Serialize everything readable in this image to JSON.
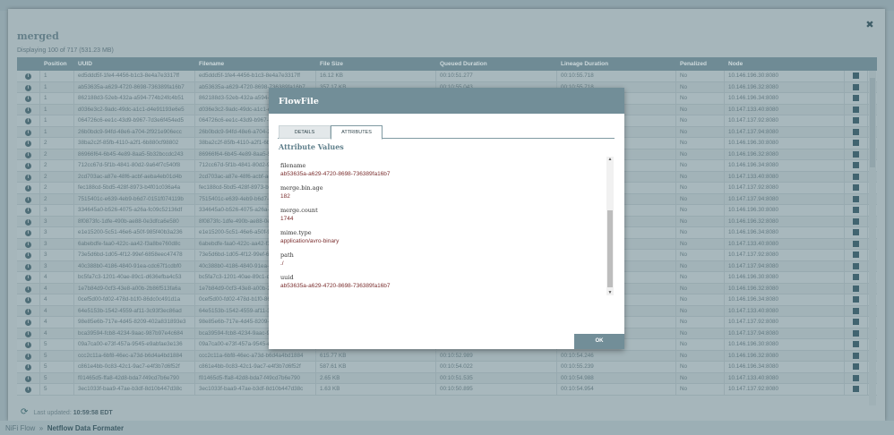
{
  "breadcrumb": {
    "root": "NiFi Flow",
    "separator": "»",
    "current": "Netflow Data Formater"
  },
  "queue_dialog": {
    "title": "merged",
    "subtitle": "Displaying 100 of 717 (531.23 MB)",
    "close_icon": "close-icon",
    "columns": [
      "",
      "Position",
      "UUID",
      "Filename",
      "File Size",
      "Queued Duration",
      "Lineage Duration",
      "Penalized",
      "Node",
      ""
    ],
    "rows": [
      {
        "position": "1",
        "uuid": "ed5ddd5f-1fe4-4456-b1c3-8e4a7e3317ff",
        "filename": "ed5ddd5f-1fe4-4456-b1c3-8e4a7e3317ff",
        "size": "16.12 KB",
        "queued": "00:10:51.277",
        "lineage": "00:10:55.718",
        "penalized": "No",
        "node": "10.146.196.30:8080"
      },
      {
        "position": "1",
        "uuid": "ab53635a-a629-4720-8698-736389fa16b7",
        "filename": "ab53635a-a629-4720-8698-736389fa16b7",
        "size": "357.17 KB",
        "queued": "00:10:55.043",
        "lineage": "00:10:55.718",
        "penalized": "No",
        "node": "10.146.196.32:8080"
      },
      {
        "position": "1",
        "uuid": "862188d3-52eb-432a-a594-774b24fc4b51",
        "filename": "862188d3-52eb-432a-a594-774b24fc4b51",
        "penalized": "No",
        "node": "10.146.196.34:8080"
      },
      {
        "position": "1",
        "uuid": "d036e3c2-9adc-49dc-a1c1-d4e91193e6e5",
        "filename": "d036e3c2-9adc-49dc-a1c1-d4e91193e6e5",
        "penalized": "No",
        "node": "10.147.133.40:8080"
      },
      {
        "position": "1",
        "uuid": "064726c6-ee1c-43d9-b967-7d3e6f454ed5",
        "filename": "064726c6-ee1c-43d9-b967-7d3e6f454ed5",
        "penalized": "No",
        "node": "10.147.137.92:8080"
      },
      {
        "position": "1",
        "uuid": "26b0bdc9-94fd-48e6-a704-2f921e906ecc",
        "filename": "26b0bdc9-94fd-48e6-a704-2f921e906ecc",
        "penalized": "No",
        "node": "10.147.137.94:8080"
      },
      {
        "position": "2",
        "uuid": "38ba2c2f-85fb-4110-a2f1-6b880cf98802",
        "filename": "38ba2c2f-85fb-4110-a2f1-6b880cf98802",
        "penalized": "No",
        "node": "10.146.196.30:8080"
      },
      {
        "position": "2",
        "uuid": "86966f64-6b45-4e89-8aa5-5b32bccdc243",
        "filename": "86966f64-6b45-4e89-8aa5-5b32bccdc243",
        "penalized": "No",
        "node": "10.146.196.32:8080"
      },
      {
        "position": "2",
        "uuid": "712cc67d-5f1b-4841-80d2-9a64f7c540f8",
        "filename": "712cc67d-5f1b-4841-80d2-9a64f7c540f8",
        "penalized": "No",
        "node": "10.146.196.34:8080"
      },
      {
        "position": "2",
        "uuid": "2cd703ac-a87e-48f6-acbf-aeba4eb01d4b",
        "filename": "2cd703ac-a87e-48f6-acbf-aeba4eb01d4b",
        "penalized": "No",
        "node": "10.147.133.40:8080"
      },
      {
        "position": "2",
        "uuid": "fec188cd-5bd5-428f-8973-b4f01c036a4a",
        "filename": "fec188cd-5bd5-428f-8973-b4f01c036a4a",
        "penalized": "No",
        "node": "10.147.137.92:8080"
      },
      {
        "position": "2",
        "uuid": "7515401c-e639-4eb9-b6d7-0151f074119b",
        "filename": "7515401c-e639-4eb9-b6d7-0151f074119b",
        "penalized": "No",
        "node": "10.147.137.94:8080"
      },
      {
        "position": "3",
        "uuid": "334645a0-b526-4075-a26a-fc09c52136df",
        "filename": "334645a0-b526-4075-a26a-fc09c52136df",
        "penalized": "No",
        "node": "10.146.196.30:8080"
      },
      {
        "position": "3",
        "uuid": "8f0873fc-1dfe-490b-ae88-0e3dfca6e580",
        "filename": "8f0873fc-1dfe-490b-ae88-0e3dfca6e580",
        "penalized": "No",
        "node": "10.146.196.32:8080"
      },
      {
        "position": "3",
        "uuid": "e1e15200-5c51-46e6-a50f-985f40b3a236",
        "filename": "e1e15200-5c51-46e6-a50f-985f40b3a236",
        "penalized": "No",
        "node": "10.146.196.34:8080"
      },
      {
        "position": "3",
        "uuid": "6abebdfe-faa0-422c-aa42-f3a8be760d8c",
        "filename": "6abebdfe-faa0-422c-aa42-f3a8be760d8c",
        "penalized": "No",
        "node": "10.147.133.40:8080"
      },
      {
        "position": "3",
        "uuid": "73e5d6bd-1d05-4f12-99ef-6858eec47478",
        "filename": "73e5d6bd-1d05-4f12-99ef-6858eec47478",
        "penalized": "No",
        "node": "10.147.137.92:8080"
      },
      {
        "position": "3",
        "uuid": "40c388b0-4186-4840-91ea-cdc67f1cdbf0",
        "filename": "40c388b0-4186-4840-91ea-cdc67f1cdbf0",
        "penalized": "No",
        "node": "10.147.137.94:8080"
      },
      {
        "position": "4",
        "uuid": "bc5fa7c3-1201-40ae-89c1-d636efba4c53",
        "filename": "bc5fa7c3-1201-40ae-89c1-d636efba4c53",
        "penalized": "No",
        "node": "10.146.196.30:8080"
      },
      {
        "position": "4",
        "uuid": "1e7b84d9-0cf3-43e8-a00b-2b86f513fa6a",
        "filename": "1e7b84d9-0cf3-43e8-a00b-2b86f513fa6a",
        "penalized": "No",
        "node": "10.146.196.32:8080"
      },
      {
        "position": "4",
        "uuid": "0cef5d00-fd02-478d-b1f0-86dc0c491d1a",
        "filename": "0cef5d00-fd02-478d-b1f0-86dc0c491d1a",
        "penalized": "No",
        "node": "10.146.196.34:8080"
      },
      {
        "position": "4",
        "uuid": "64e5153b-1542-4559-af11-3c93f3ec86ad",
        "filename": "64e5153b-1542-4559-af11-3c93f3ec86ad",
        "penalized": "No",
        "node": "10.147.133.40:8080"
      },
      {
        "position": "4",
        "uuid": "98e85e6b-717e-4d45-8209-402a831893e3",
        "filename": "98e85e6b-717e-4d45-8209-402a831893e3",
        "penalized": "No",
        "node": "10.147.137.92:8080"
      },
      {
        "position": "4",
        "uuid": "bca39594-fcb8-4234-9aac-987b97e4c684",
        "filename": "bca39594-fcb8-4234-9aac-987b97e4c684",
        "penalized": "No",
        "node": "10.147.137.94:8080"
      },
      {
        "position": "5",
        "uuid": "09a7ca00-e73f-457a-9545-e9abfae3e136",
        "filename": "09a7ca00-e73f-457a-9545-e9abfae3e136",
        "penalized": "No",
        "node": "10.146.196.30:8080"
      },
      {
        "position": "5",
        "uuid": "ccc2c11a-6bf8-46ec-a73d-b6d4a4bd1884",
        "filename": "ccc2c11a-6bf8-46ec-a73d-b6d4a4bd1884",
        "size": "615.77 KB",
        "queued": "00:10:52.989",
        "lineage": "00:10:54.246",
        "penalized": "No",
        "node": "10.146.196.32:8080"
      },
      {
        "position": "5",
        "uuid": "c861e4bb-0c83-42c1-9ac7-e4f3b7d6f52f",
        "filename": "c861e4bb-0c83-42c1-9ac7-e4f3b7d6f52f",
        "size": "587.61 KB",
        "queued": "00:10:54.022",
        "lineage": "00:10:55.239",
        "penalized": "No",
        "node": "10.146.196.34:8080"
      },
      {
        "position": "5",
        "uuid": "f01465d5-ffa8-42d8-bda7-f49cd7b6e790",
        "filename": "f01465d5-ffa8-42d8-bda7-f49cd7b6e790",
        "size": "2.65 KB",
        "queued": "00:10:51.535",
        "lineage": "00:10:54.988",
        "penalized": "No",
        "node": "10.147.133.40:8080"
      },
      {
        "position": "5",
        "uuid": "3ec1033f-baa9-47ae-b3df-8d10b447d38c",
        "filename": "3ec1033f-baa9-47ae-b3df-8d10b447d38c",
        "size": "1.63 KB",
        "queued": "00:10:50.895",
        "lineage": "00:10:54.954",
        "penalized": "No",
        "node": "10.147.137.92:8080"
      }
    ],
    "last_updated_label": "Last updated:",
    "last_updated_value": "10:59:58 EDT"
  },
  "flowfile_dialog": {
    "title": "FlowFile",
    "tabs": [
      "DETAILS",
      "ATTRIBUTES"
    ],
    "active_tab": "ATTRIBUTES",
    "section_title": "Attribute Values",
    "attributes": [
      {
        "key": "filename",
        "value": "ab53635a-a629-4720-8698-736389fa16b7"
      },
      {
        "key": "merge.bin.age",
        "value": "182"
      },
      {
        "key": "merge.count",
        "value": "1744"
      },
      {
        "key": "mime.type",
        "value": "application/avro-binary"
      },
      {
        "key": "path",
        "value": "./"
      },
      {
        "key": "uuid",
        "value": "ab53635a-a629-4720-8698-736389fa16b7"
      }
    ],
    "ok_label": "OK"
  }
}
